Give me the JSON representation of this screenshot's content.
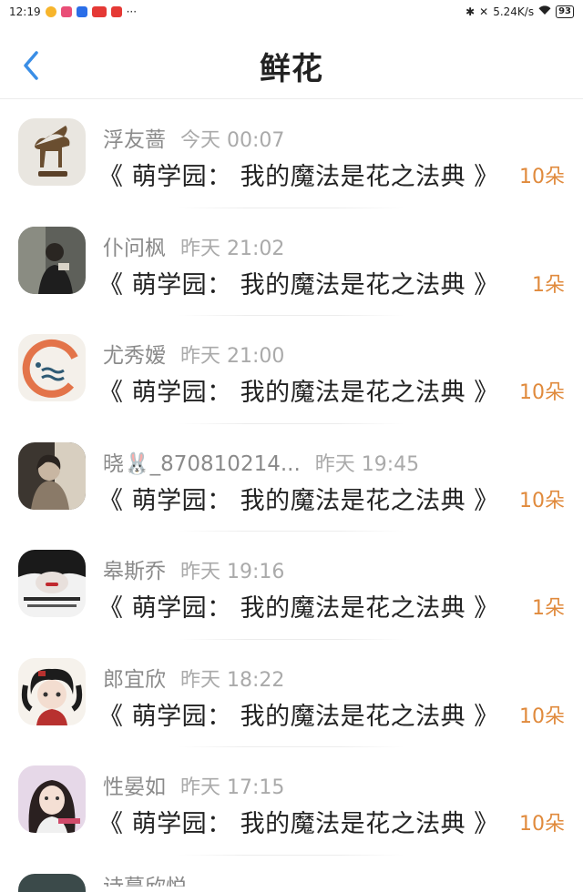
{
  "status_bar": {
    "time": "12:19",
    "speed": "5.24K/s",
    "battery": "93"
  },
  "header": {
    "title": "鲜花"
  },
  "records": [
    {
      "name": "浮友蔷",
      "time": "今天 00:07",
      "book": "《 萌学园： 我的魔法是花之法典 》",
      "amount": "10朵",
      "avatar_icon": "goat-statue-avatar"
    },
    {
      "name": "仆问枫",
      "time": "昨天 21:02",
      "book": "《 萌学园： 我的魔法是花之法典 》",
      "amount": "1朵",
      "avatar_icon": "person-photo-avatar"
    },
    {
      "name": "尤秀嫒",
      "time": "昨天 21:00",
      "book": "《 萌学园： 我的魔法是花之法典 》",
      "amount": "10朵",
      "avatar_icon": "orange-ring-logo-avatar"
    },
    {
      "name": "晓🐰_870810214...",
      "time": "昨天 19:45",
      "book": "《 萌学园： 我的魔法是花之法典 》",
      "amount": "10朵",
      "avatar_icon": "portrait-photo-avatar"
    },
    {
      "name": "皋斯乔",
      "time": "昨天 19:16",
      "book": "《 萌学园： 我的魔法是花之法典 》",
      "amount": "1朵",
      "avatar_icon": "art-face-avatar"
    },
    {
      "name": "郎宜欣",
      "time": "昨天 18:22",
      "book": "《 萌学园： 我的魔法是花之法典 》",
      "amount": "10朵",
      "avatar_icon": "anime-girl-avatar"
    },
    {
      "name": "性晏如",
      "time": "昨天 17:15",
      "book": "《 萌学园： 我的魔法是花之法典 》",
      "amount": "10朵",
      "avatar_icon": "girl-photo-avatar"
    }
  ],
  "partial_row": {
    "name": "诗蔓欣悦"
  },
  "colors": {
    "accent_blue": "#3a8ee6",
    "amount_orange": "#e08a3c"
  }
}
